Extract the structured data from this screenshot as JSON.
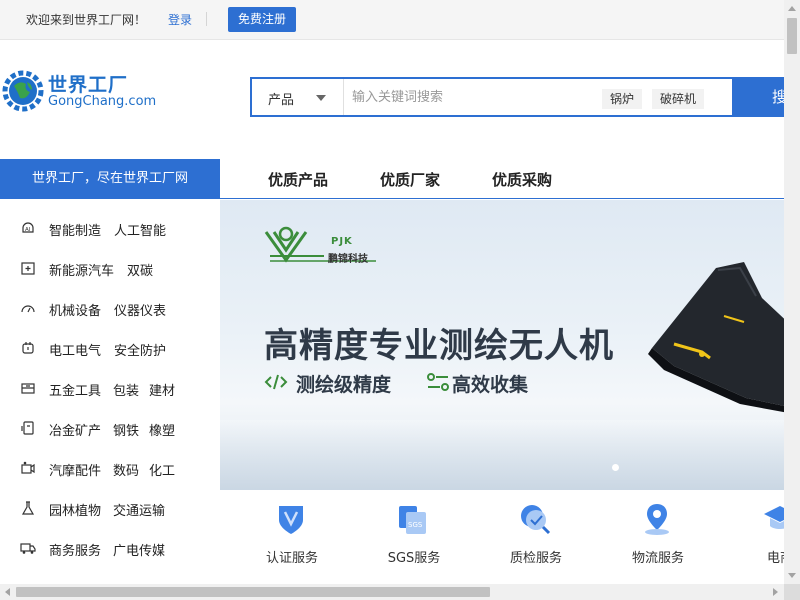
{
  "topbar": {
    "welcome": "欢迎来到世界工厂网！",
    "login": "登录",
    "register": "免费注册"
  },
  "logo": {
    "name_cn": "世界工厂",
    "name_en": "GongChang.com"
  },
  "search": {
    "category": "产品",
    "placeholder": "输入关键词搜索",
    "hot_keywords": [
      "锅炉",
      "破碎机"
    ],
    "button": "搜"
  },
  "nav": {
    "category_title": "世界工厂，尽在世界工厂网",
    "links": [
      "优质产品",
      "优质厂家",
      "优质采购"
    ]
  },
  "categories": [
    {
      "icon": "ai-chip-icon",
      "items": [
        "智能制造",
        "人工智能"
      ]
    },
    {
      "icon": "battery-plus-icon",
      "items": [
        "新能源汽车",
        "双碳"
      ]
    },
    {
      "icon": "gauge-icon",
      "items": [
        "机械设备",
        "仪器仪表"
      ]
    },
    {
      "icon": "plug-icon",
      "items": [
        "电工电气",
        "安全防护"
      ]
    },
    {
      "icon": "toolbox-icon",
      "items": [
        "五金工具",
        "包装",
        "建材"
      ]
    },
    {
      "icon": "mine-cart-icon",
      "items": [
        "冶金矿产",
        "钢铁",
        "橡塑"
      ]
    },
    {
      "icon": "car-parts-icon",
      "items": [
        "汽摩配件",
        "数码",
        "化工"
      ]
    },
    {
      "icon": "flask-icon",
      "items": [
        "园林植物",
        "交通运输"
      ]
    },
    {
      "icon": "truck-icon",
      "items": [
        "商务服务",
        "广电传媒"
      ]
    }
  ],
  "banner": {
    "brand_en": "PJK",
    "brand_cn": "鹏锦科技",
    "headline": "高精度专业测绘无人机",
    "features": [
      {
        "icon": "code-icon",
        "text": "测绘级精度"
      },
      {
        "icon": "sliders-icon",
        "text": "高效收集"
      }
    ],
    "colors": {
      "brand_green": "#3b8d3b",
      "text_dark": "#2f3a48"
    }
  },
  "services": [
    {
      "icon": "shield-v-icon",
      "label": "认证服务"
    },
    {
      "icon": "sgs-doc-icon",
      "label": "SGS服务"
    },
    {
      "icon": "magnifier-check-icon",
      "label": "质检服务"
    },
    {
      "icon": "map-pin-icon",
      "label": "物流服务"
    },
    {
      "icon": "graduation-cap-icon",
      "label": "电商"
    }
  ],
  "theme": {
    "accent": "#2d6fd2"
  }
}
